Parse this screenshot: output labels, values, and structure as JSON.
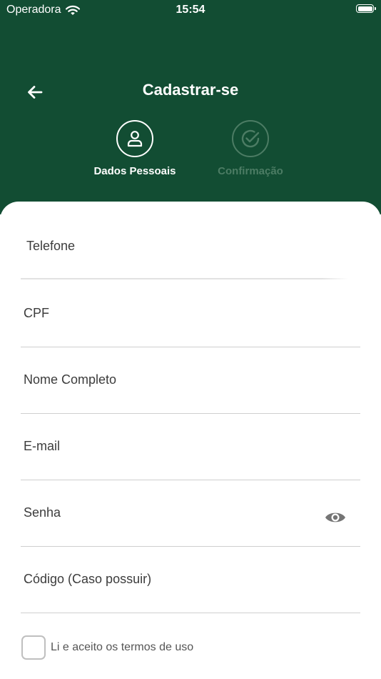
{
  "status_bar": {
    "carrier": "Operadora",
    "time": "15:54"
  },
  "header": {
    "title": "Cadastrar-se",
    "back_icon": "arrow-left-icon"
  },
  "steps": [
    {
      "label": "Dados Pessoais",
      "icon": "person-icon",
      "active": true
    },
    {
      "label": "Confirmação",
      "icon": "check-circle-icon",
      "active": false
    }
  ],
  "form": {
    "fields": [
      {
        "label": "Telefone"
      },
      {
        "label": "CPF"
      },
      {
        "label": "Nome Completo"
      },
      {
        "label": "E-mail"
      },
      {
        "label": "Senha",
        "icon": "eye-icon"
      },
      {
        "label": "Código (Caso possuir)"
      }
    ],
    "terms_label": "Li e aceito os termos de uso"
  },
  "colors": {
    "header_bg": "#124d33",
    "inactive_step": "#4c7c64",
    "text": "#3c3c3c"
  }
}
